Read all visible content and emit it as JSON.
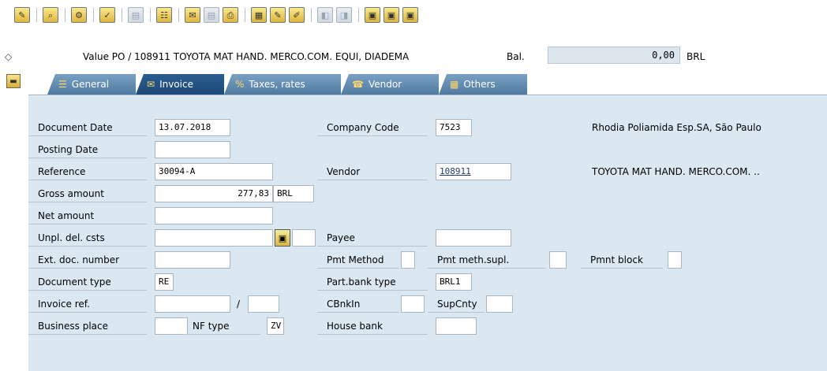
{
  "toolbar": {
    "buttons": [
      {
        "name": "edit-icon",
        "glyph": "✎"
      },
      {
        "name": "display-change-icon",
        "glyph": "⌕"
      },
      {
        "name": "hold-icon",
        "glyph": "⚙"
      },
      {
        "name": "check-icon",
        "glyph": "✓"
      },
      {
        "name": "doc-disabled-icon",
        "glyph": "▤"
      },
      {
        "name": "simulate-icon",
        "glyph": "☷"
      },
      {
        "name": "messages-icon",
        "glyph": "✉"
      },
      {
        "name": "overview-disabled-icon",
        "glyph": "▤"
      },
      {
        "name": "print-icon",
        "glyph": "⎙"
      },
      {
        "name": "calendar-icon",
        "glyph": "▦"
      },
      {
        "name": "edit-doc-icon",
        "glyph": "✎"
      },
      {
        "name": "pencil-icon",
        "glyph": "✐"
      },
      {
        "name": "prev-disabled-icon",
        "glyph": "◧"
      },
      {
        "name": "next-disabled-icon",
        "glyph": "◨"
      },
      {
        "name": "save-layout-icon",
        "glyph": "▣"
      },
      {
        "name": "layout-icon",
        "glyph": "▣"
      },
      {
        "name": "settings-icon",
        "glyph": "▣"
      }
    ]
  },
  "header": {
    "title": "Value PO / 108911 TOYOTA MAT HAND. MERCO.COM. EQUI, DIADEMA",
    "balance_label": "Bal.",
    "balance_value": "0,00",
    "balance_currency": "BRL"
  },
  "tabs": [
    {
      "label": "General",
      "icon": "☰"
    },
    {
      "label": "Invoice",
      "icon": "✉"
    },
    {
      "label": "Taxes, rates",
      "icon": "%"
    },
    {
      "label": "Vendor",
      "icon": "☎"
    },
    {
      "label": "Others",
      "icon": "▦"
    }
  ],
  "form": {
    "document_date_label": "Document Date",
    "document_date": "13.07.2018",
    "posting_date_label": "Posting Date",
    "posting_date": "",
    "reference_label": "Reference",
    "reference": "30094-A",
    "gross_amount_label": "Gross amount",
    "gross_amount": "277,83",
    "gross_currency": "BRL",
    "net_amount_label": "Net amount",
    "net_amount": "",
    "unpl_label": "Unpl. del. csts",
    "unpl_value": "",
    "unpl_currency": "",
    "ext_doc_label": "Ext. doc. number",
    "ext_doc": "",
    "doc_type_label": "Document type",
    "doc_type": "RE",
    "invoice_ref_label": "Invoice ref.",
    "invoice_ref_1": "",
    "invoice_ref_sep": "/",
    "invoice_ref_2": "",
    "business_place_label": "Business place",
    "business_place": "",
    "nf_type_label": "NF type",
    "nf_type": "ZV",
    "company_code_label": "Company Code",
    "company_code": "7523",
    "company_name": "Rhodia Poliamida Esp.SA, São Paulo",
    "vendor_label": "Vendor",
    "vendor": "108911",
    "vendor_name": "TOYOTA MAT HAND. MERCO.COM. ..",
    "payee_label": "Payee",
    "payee": "",
    "pmt_method_label": "Pmt Method",
    "pmt_method": "",
    "pmt_meth_supl_label": "Pmt meth.supl.",
    "pmt_meth_supl": "",
    "pmnt_block_label": "Pmnt block",
    "pmnt_block": "",
    "part_bank_label": "Part.bank type",
    "part_bank": "BRL1",
    "cbankin_label": "CBnkIn",
    "cbankin": "",
    "supcnty_label": "SupCnty",
    "supcnty": "",
    "house_bank_label": "House bank",
    "house_bank": ""
  }
}
